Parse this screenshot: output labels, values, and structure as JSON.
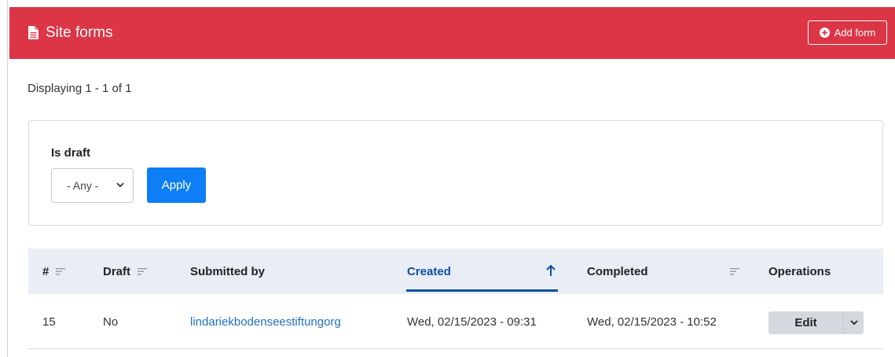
{
  "header": {
    "title": "Site forms",
    "add_form_label": "Add form",
    "icon": "document-icon",
    "add_icon": "plus-circle-icon",
    "color": "#dc3545"
  },
  "summary": "Displaying 1 - 1 of 1",
  "filter": {
    "label": "Is draft",
    "select_value": "- Any -",
    "apply_label": "Apply",
    "apply_color": "#0d7ef5"
  },
  "table": {
    "columns": [
      {
        "label": "#",
        "sortable": true
      },
      {
        "label": "Draft",
        "sortable": true
      },
      {
        "label": "Submitted by",
        "sortable": false
      },
      {
        "label": "Created",
        "sortable": true,
        "active": true,
        "direction": "ascending"
      },
      {
        "label": "Completed",
        "sortable": true
      },
      {
        "label": "Operations",
        "sortable": false
      }
    ],
    "rows": [
      {
        "id": "15",
        "draft": "No",
        "submitted_by": "lindariekbodenseestiftungorg",
        "created": "Wed, 02/15/2023 - 09:31",
        "completed": "Wed, 02/15/2023 - 10:52",
        "operation_label": "Edit"
      }
    ],
    "active_sort_color": "#0d4ea6",
    "link_color": "#1f6fc5"
  }
}
